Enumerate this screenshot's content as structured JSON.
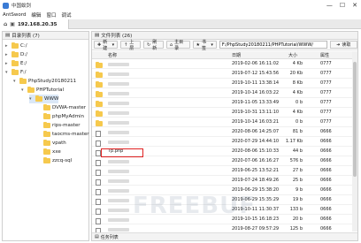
{
  "window": {
    "title": "中国蚁剑",
    "min": "—",
    "max": "☐",
    "close": "✕"
  },
  "menu": [
    "AntSword",
    "编辑",
    "窗口",
    "调试"
  ],
  "tab": {
    "label": "192.168.20.35",
    "home": "⌂"
  },
  "sidebar": {
    "header": "目录列表 (7)",
    "tree": [
      {
        "label": "C:/",
        "depth": 0,
        "expanded": false
      },
      {
        "label": "D:/",
        "depth": 0,
        "expanded": false
      },
      {
        "label": "E:/",
        "depth": 0,
        "expanded": false
      },
      {
        "label": "F:/",
        "depth": 0,
        "expanded": true
      },
      {
        "label": "PhpStudy20180211",
        "depth": 1,
        "expanded": true
      },
      {
        "label": "PHPTutorial",
        "depth": 2,
        "expanded": true
      },
      {
        "label": "WWW",
        "depth": 3,
        "expanded": true,
        "selected": true
      },
      {
        "label": "DVWA-master",
        "depth": 4,
        "expanded": false
      },
      {
        "label": "phpMyAdmin",
        "depth": 4,
        "expanded": false
      },
      {
        "label": "rips-master",
        "depth": 4,
        "expanded": false
      },
      {
        "label": "taocms-master",
        "depth": 4,
        "expanded": false
      },
      {
        "label": "vpath",
        "depth": 4,
        "expanded": false
      },
      {
        "label": "xxe",
        "depth": 4,
        "expanded": false
      },
      {
        "label": "zzcq-sql",
        "depth": 4,
        "expanded": false
      }
    ]
  },
  "main": {
    "header": "文件列表 (26)",
    "toolbar": {
      "new": "新建",
      "up": "上层",
      "refresh": "刷新",
      "home": "主目录",
      "bookmark": "书签",
      "path": "F:/PhpStudy20180211/PHPTutorial/WWW/",
      "go": "读取"
    },
    "columns": {
      "name": "名称",
      "date": "日期",
      "size": "大小",
      "attr": "属性"
    },
    "files": [
      {
        "type": "folder",
        "name": "",
        "date": "2019-02-06 16:11:02",
        "size": "4 Kb",
        "attr": "0777"
      },
      {
        "type": "folder",
        "name": "",
        "date": "2019-07-12 15:43:56",
        "size": "20 Kb",
        "attr": "0777"
      },
      {
        "type": "folder",
        "name": "",
        "date": "2019-10-11 13:38:14",
        "size": "8 Kb",
        "attr": "0777"
      },
      {
        "type": "folder",
        "name": "",
        "date": "2019-10-14 16:03:22",
        "size": "4 Kb",
        "attr": "0777"
      },
      {
        "type": "folder",
        "name": "",
        "date": "2019-11-05 13:33:49",
        "size": "0 b",
        "attr": "0777"
      },
      {
        "type": "folder",
        "name": "",
        "date": "2019-10-31 13:11:10",
        "size": "4 Kb",
        "attr": "0777"
      },
      {
        "type": "folder",
        "name": "",
        "date": "2019-10-14 16:03:21",
        "size": "0 b",
        "attr": "0777"
      },
      {
        "type": "file",
        "name": "",
        "date": "2020-08-06 14:25:07",
        "size": "81 b",
        "attr": "0666"
      },
      {
        "type": "file",
        "name": "",
        "date": "2020-07-29 14:44:10",
        "size": "1.17 Kb",
        "attr": "0666"
      },
      {
        "type": "file",
        "name": "Tp.php",
        "date": "2020-08-06 15:10:33",
        "size": "44 b",
        "attr": "0666",
        "highlight": true
      },
      {
        "type": "file",
        "name": "",
        "date": "2020-07-06 16:16:27",
        "size": "576 b",
        "attr": "0666"
      },
      {
        "type": "file",
        "name": "",
        "date": "2019-06-25 13:52:21",
        "size": "27 b",
        "attr": "0666"
      },
      {
        "type": "file",
        "name": "",
        "date": "2019-07-24 18:49:26",
        "size": "25 b",
        "attr": "0666"
      },
      {
        "type": "file",
        "name": "",
        "date": "2019-06-29 15:38:20",
        "size": "9 b",
        "attr": "0666"
      },
      {
        "type": "file",
        "name": "",
        "date": "2019-06-29 15:35:29",
        "size": "19 b",
        "attr": "0666"
      },
      {
        "type": "file",
        "name": "",
        "date": "2019-10-11 11:30:37",
        "size": "133 b",
        "attr": "0666"
      },
      {
        "type": "file",
        "name": "",
        "date": "2019-10-15 16:18:23",
        "size": "20 b",
        "attr": "0666"
      },
      {
        "type": "file",
        "name": "",
        "date": "2019-08-27 09:57:29",
        "size": "125 b",
        "attr": "0666"
      }
    ],
    "footer": "任务列表"
  },
  "watermark": "FREEBUF"
}
